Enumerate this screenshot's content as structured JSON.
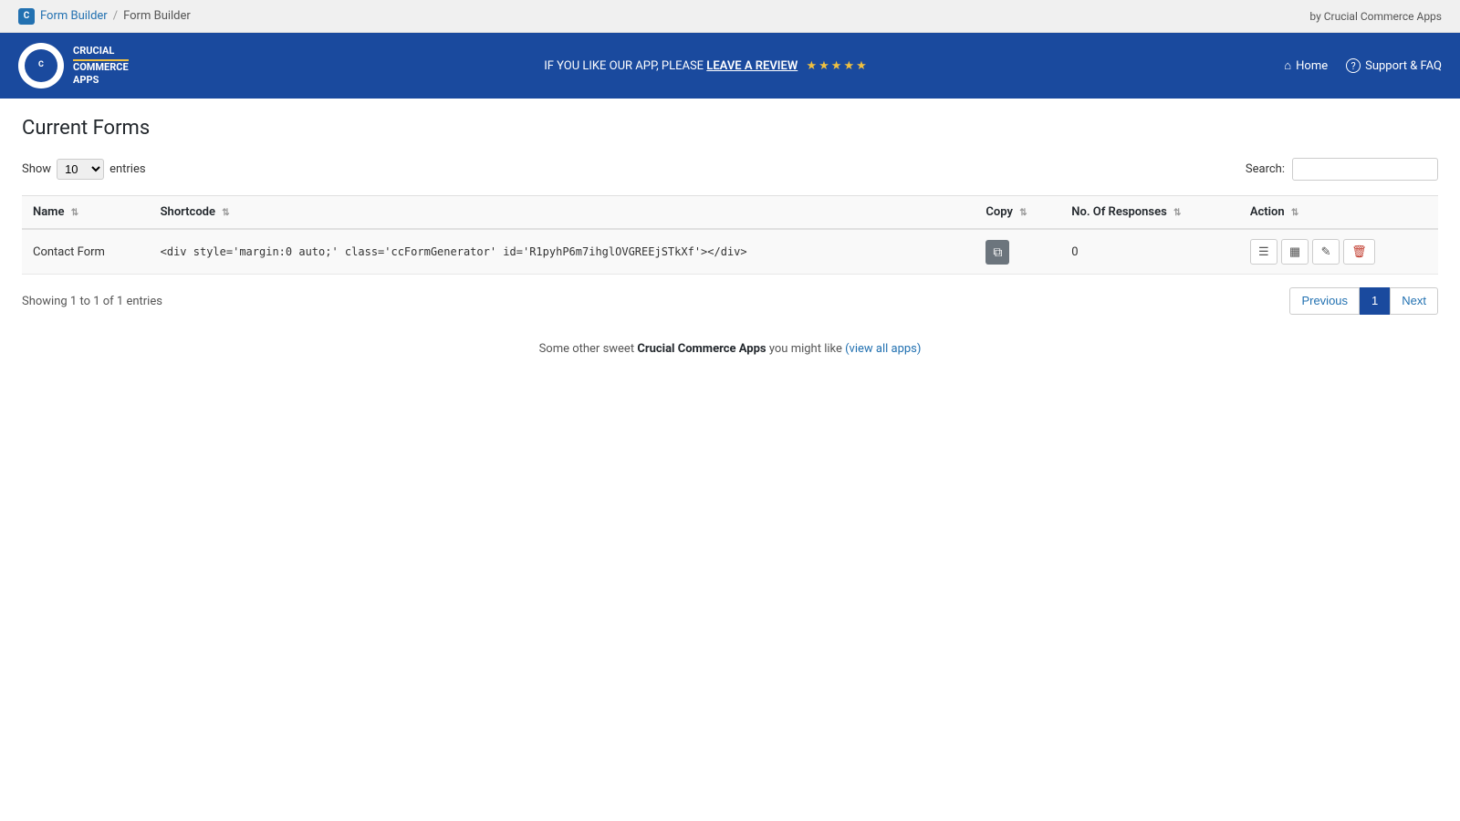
{
  "admin_bar": {
    "icon_label": "C",
    "breadcrumb_root": "Form Builder",
    "breadcrumb_sep": "/",
    "breadcrumb_current": "Form Builder",
    "by_label": "by Crucial Commerce Apps"
  },
  "header": {
    "logo_line1": "CRUCIAL",
    "logo_line2": "COMMERCE",
    "logo_line3": "APPS",
    "banner_text_before": "IF YOU LIKE OUR APP, PLEASE ",
    "banner_link": "LEAVE A REVIEW",
    "stars": "★★★★★",
    "nav_home": "Home",
    "nav_support": "Support & FAQ"
  },
  "page": {
    "title": "Current Forms",
    "show_label": "Show",
    "entries_label": "entries",
    "show_value": "10",
    "search_label": "Search:",
    "search_value": "",
    "table": {
      "columns": [
        {
          "key": "name",
          "label": "Name"
        },
        {
          "key": "shortcode",
          "label": "Shortcode"
        },
        {
          "key": "copy",
          "label": "Copy"
        },
        {
          "key": "responses",
          "label": "No. Of Responses"
        },
        {
          "key": "action",
          "label": "Action"
        }
      ],
      "rows": [
        {
          "name": "Contact Form",
          "shortcode": "<div style='margin:0 auto;' class='ccFormGenerator' id='R1pyhP6m7ihglOVGREEjSTkXf'></div>",
          "responses": "0"
        }
      ]
    },
    "footer_info": "Showing 1 to 1 of 1 entries",
    "pagination": {
      "previous": "Previous",
      "current_page": "1",
      "next": "Next"
    },
    "promo_before": "Some other sweet ",
    "promo_brand": "Crucial Commerce Apps",
    "promo_after": " you might like ",
    "promo_link_text": "(view all apps)",
    "promo_link_href": "#"
  },
  "icons": {
    "home": "⌂",
    "support": "?",
    "copy": "❑",
    "list": "☰",
    "layout": "▦",
    "edit": "✎",
    "delete": "🗑"
  }
}
